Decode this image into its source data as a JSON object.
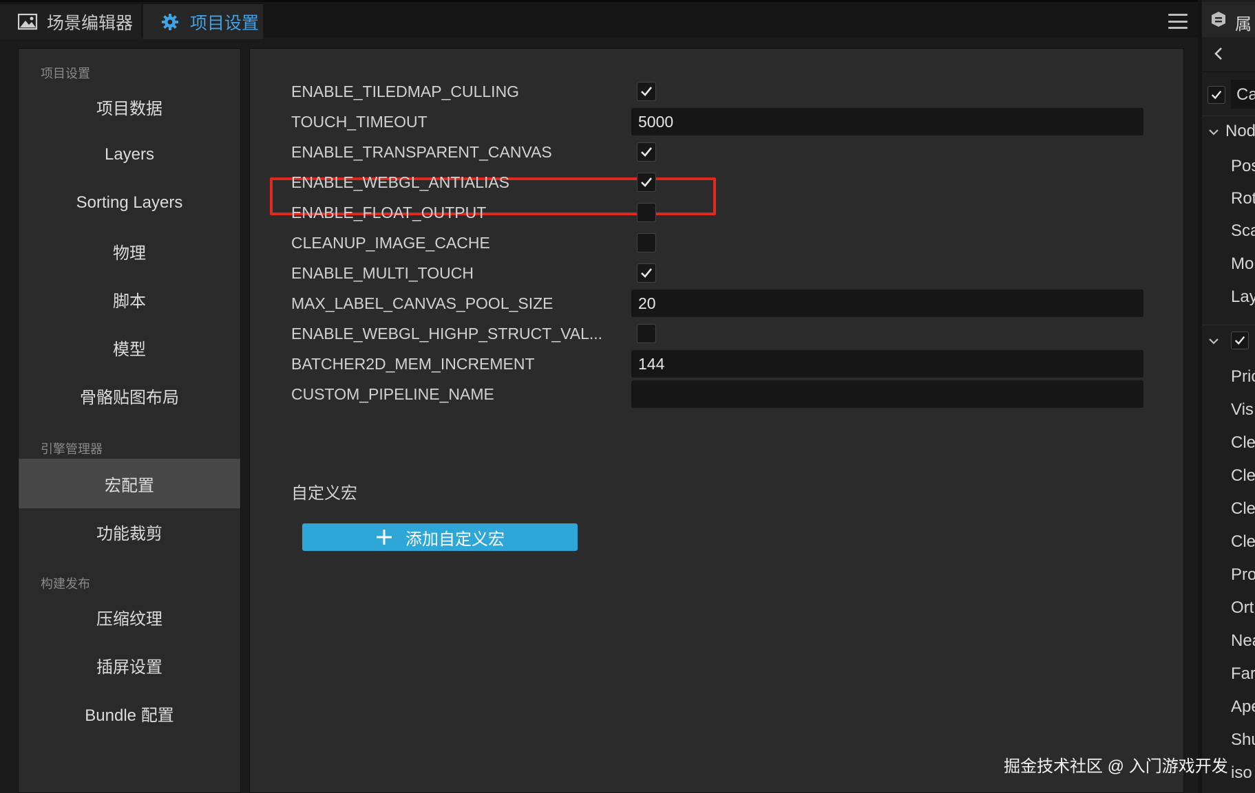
{
  "tabs": [
    {
      "label": "场景编辑器",
      "icon": "image-icon"
    },
    {
      "label": "项目设置",
      "icon": "gear-icon",
      "active": true
    }
  ],
  "sidebar": {
    "sections": [
      {
        "title": "项目设置",
        "items": [
          "项目数据",
          "Layers",
          "Sorting Layers",
          "物理",
          "脚本",
          "模型",
          "骨骼贴图布局"
        ]
      },
      {
        "title": "引擎管理器",
        "items": [
          "宏配置",
          "功能裁剪"
        ]
      },
      {
        "title": "构建发布",
        "items": [
          "压缩纹理",
          "插屏设置",
          "Bundle 配置"
        ]
      }
    ],
    "active_item": "宏配置"
  },
  "settings": [
    {
      "label": "ENABLE_TILEDMAP_CULLING",
      "type": "checkbox",
      "checked": true
    },
    {
      "label": "TOUCH_TIMEOUT",
      "type": "text",
      "value": "5000"
    },
    {
      "label": "ENABLE_TRANSPARENT_CANVAS",
      "type": "checkbox",
      "checked": true
    },
    {
      "label": "ENABLE_WEBGL_ANTIALIAS",
      "type": "checkbox",
      "checked": true,
      "highlighted": true
    },
    {
      "label": "ENABLE_FLOAT_OUTPUT",
      "type": "checkbox",
      "checked": false
    },
    {
      "label": "CLEANUP_IMAGE_CACHE",
      "type": "checkbox",
      "checked": false
    },
    {
      "label": "ENABLE_MULTI_TOUCH",
      "type": "checkbox",
      "checked": true
    },
    {
      "label": "MAX_LABEL_CANVAS_POOL_SIZE",
      "type": "text",
      "value": "20"
    },
    {
      "label": "ENABLE_WEBGL_HIGHP_STRUCT_VAL...",
      "type": "checkbox",
      "checked": false
    },
    {
      "label": "BATCHER2D_MEM_INCREMENT",
      "type": "text",
      "value": "144"
    },
    {
      "label": "CUSTOM_PIPELINE_NAME",
      "type": "text",
      "value": ""
    }
  ],
  "custom_macro": {
    "title": "自定义宏",
    "add_button_label": "添加自定义宏"
  },
  "inspector": {
    "header_label": "属",
    "items": [
      "Ca",
      "Nod",
      "Pos",
      "Rot",
      "Sca",
      "Mo",
      "Lay",
      "Pric",
      "Vis",
      "Cle",
      "Cle",
      "Cle",
      "Cle",
      "Pro",
      "Ort",
      "Nea",
      "Far",
      "Ape",
      "Shu",
      "iso"
    ]
  },
  "watermark": "掘金技术社区 @ 入门游戏开发",
  "colors": {
    "accent": "#3fa3e6",
    "button": "#2ea6d8",
    "highlight": "#e0281f"
  }
}
